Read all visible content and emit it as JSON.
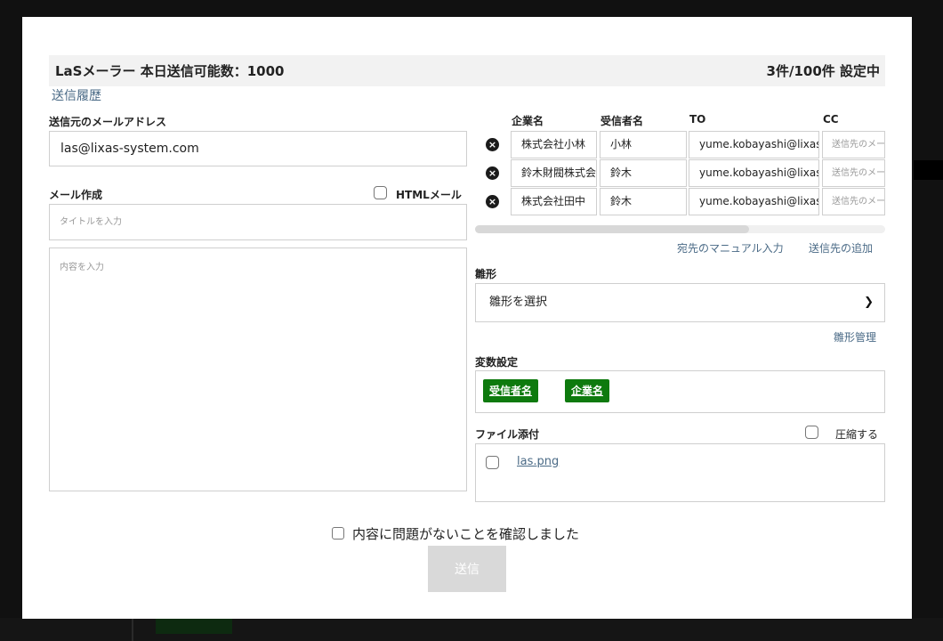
{
  "header": {
    "title": "LaSメーラー 本日送信可能数：1000",
    "count": "3件/100件 設定中"
  },
  "history_link": "送信履歴",
  "sender": {
    "label": "送信元のメールアドレス",
    "value": "las@lixas-system.com"
  },
  "compose": {
    "label": "メール作成",
    "html_label": "HTMLメール",
    "title_placeholder": "タイトルを入力",
    "body_placeholder": "内容を入力"
  },
  "recipients": {
    "headers": [
      "企業名",
      "受信者名",
      "TO",
      "CC"
    ],
    "rows": [
      {
        "company": "株式会社小林",
        "name": "小林",
        "to": "yume.kobayashi@lixas",
        "cc": "送信先のメールアドレス"
      },
      {
        "company": "鈴木財閥株式会社",
        "name": "鈴木",
        "to": "yume.kobayashi@lixas",
        "cc": "送信先のメールアドレス"
      },
      {
        "company": "株式会社田中",
        "name": "鈴木",
        "to": "yume.kobayashi@lixas",
        "cc": "送信先のメールアドレス"
      }
    ],
    "manual_link": "宛先のマニュアル入力",
    "add_link": "送信先の追加"
  },
  "template": {
    "label": "雛形",
    "select_value": "雛形を選択",
    "manage_link": "雛形管理"
  },
  "variables": {
    "label": "変数設定",
    "chips": [
      "受信者名",
      "企業名"
    ]
  },
  "attachments": {
    "label": "ファイル添付",
    "compress_label": "圧縮する",
    "file_name": "las.png"
  },
  "confirm_label": "内容に問題がないことを確認しました",
  "send_label": "送信",
  "colors": {
    "accent_green": "#0e7a0e",
    "link": "#4a6a86",
    "disabled_button": "#d9d9d9"
  }
}
